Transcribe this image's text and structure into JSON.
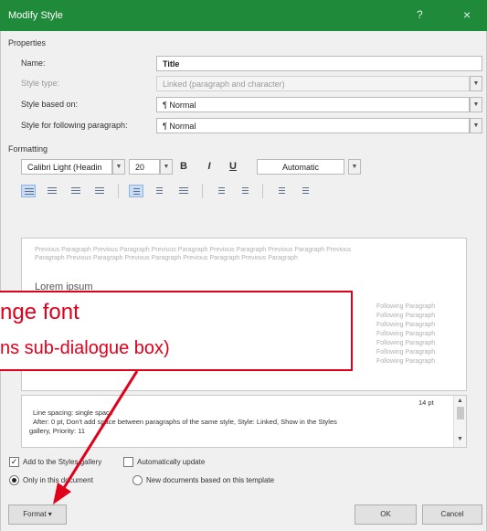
{
  "window": {
    "title": "Modify Style",
    "help_glyph": "?",
    "close_glyph": "×"
  },
  "properties": {
    "heading": "Properties",
    "name_label": "Name:",
    "name_value": "Title",
    "style_type_label": "Style type:",
    "style_type_value": "Linked (paragraph and character)",
    "based_on_label": "Style based on:",
    "based_on_value": "¶ Normal",
    "following_label": "Style for following paragraph:",
    "following_value": "¶ Normal"
  },
  "formatting": {
    "heading": "Formatting",
    "font_value": "Calibri Light (Headin",
    "size_value": "20",
    "bold_label": "B",
    "italic_label": "I",
    "underline_label": "U",
    "color_value": "Automatic"
  },
  "preview": {
    "previous_paragraph_1": "Previous Paragraph Previous Paragraph Previous Paragraph Previous Paragraph Previous Paragraph Previous",
    "previous_paragraph_2": "Paragraph Previous Paragraph Previous Paragraph Previous Paragraph Previous Paragraph",
    "sample_text": "Lorem ipsum",
    "following_1": "Following Paragraph",
    "following_2": "Following Paragraph",
    "following_3": "Following Paragraph",
    "following_4": "Following Paragraph",
    "following_5": "Following Paragraph",
    "following_6": "Following Paragraph",
    "following_7": "Following Paragraph"
  },
  "description": {
    "line_1_tail": "14 pt",
    "line_2": "Line spacing:  single space",
    "line_3": "After:  0 pt, Don't add space between paragraphs of the same style, Style: Linked, Show in the Styles",
    "line_4": "gallery, Priority: 11"
  },
  "options": {
    "add_gallery_label": "Add to the Styles gallery",
    "add_gallery_checked": true,
    "auto_update_label": "Automatically update",
    "auto_update_checked": false,
    "only_doc_label": "Only in this document",
    "new_docs_label": "New documents based on this template"
  },
  "buttons": {
    "format_label": "Format ▾",
    "ok_label": "OK",
    "cancel_label": "Cancel"
  },
  "annotation": {
    "line_1": "nge font",
    "line_2": "ns sub-dialogue box)",
    "color": "#e0001b"
  },
  "colors": {
    "titlebar": "#1e8a3a",
    "dialog_bg": "#f0f0f0"
  }
}
